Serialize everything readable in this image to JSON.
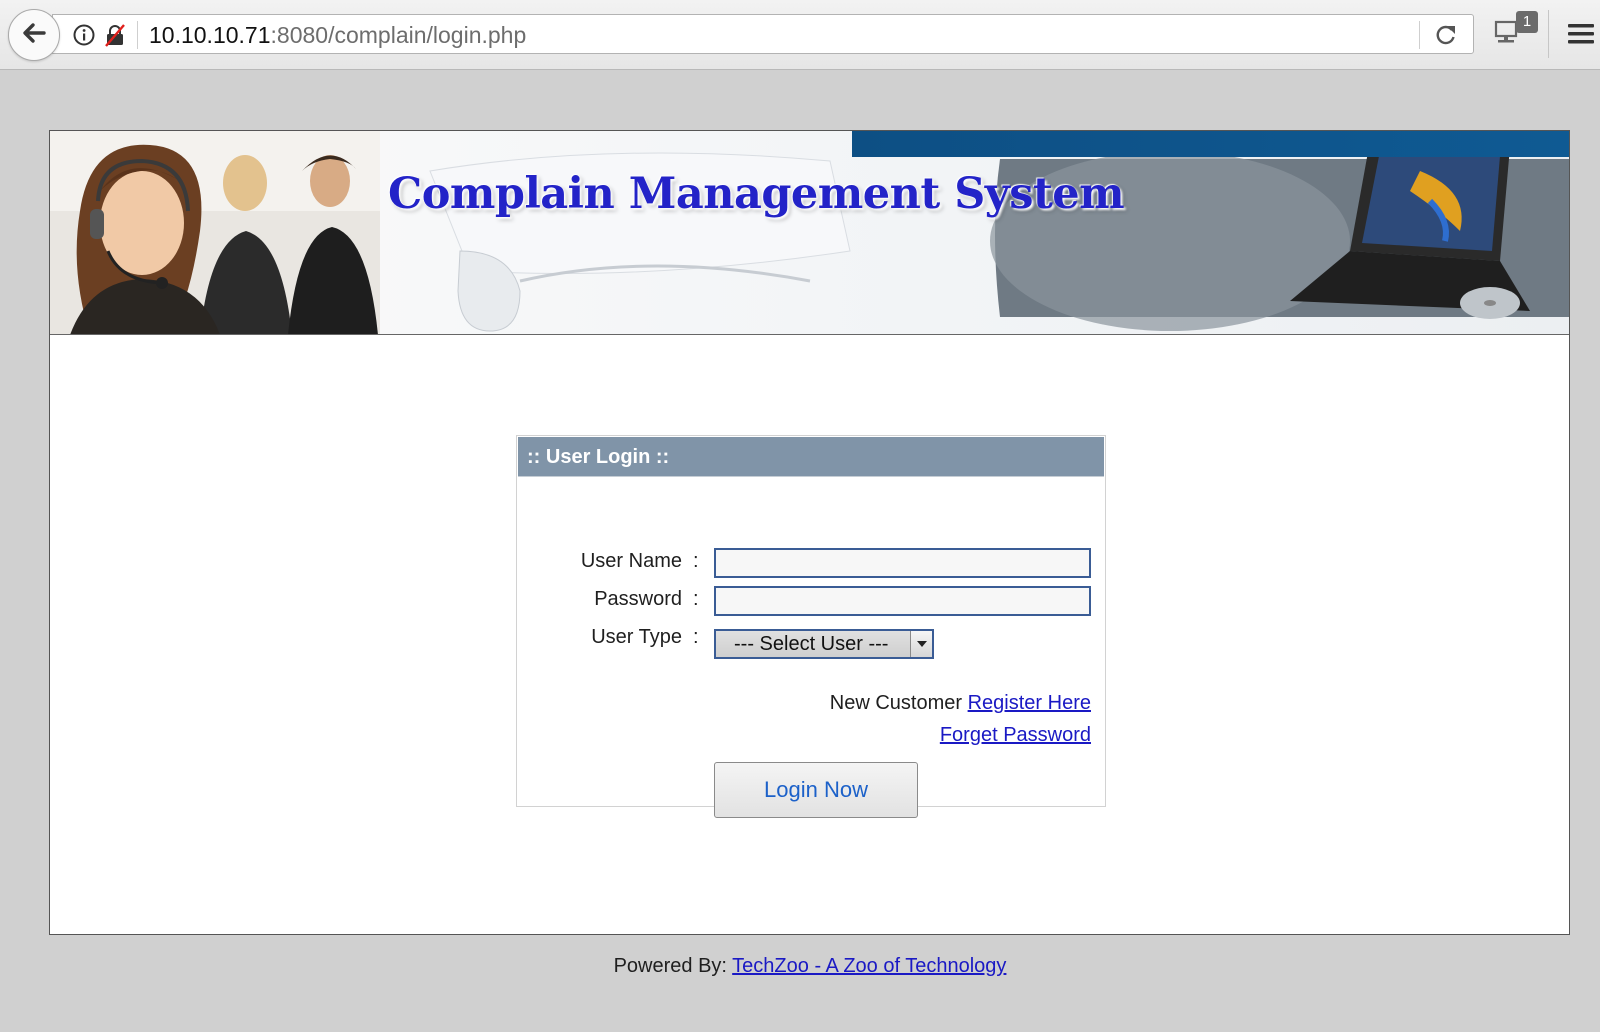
{
  "browser": {
    "url_host": "10.10.10.71",
    "url_path": ":8080/complain/login.php",
    "network_badge": "1",
    "icons": {
      "back": "back-arrow-icon",
      "info": "info-icon",
      "lock": "insecure-lock-icon",
      "reload": "reload-icon",
      "network": "network-icon",
      "menu": "hamburger-menu-icon"
    }
  },
  "banner": {
    "title": "Complain Management System"
  },
  "login": {
    "header": ":: User Login ::",
    "username_label": "User Name",
    "password_label": "Password",
    "usertype_label": "User Type",
    "colon": ":",
    "username_value": "",
    "password_value": "",
    "usertype_selected": "--- Select User ---",
    "new_customer_text": "New Customer",
    "register_link": "Register Here",
    "forget_link": "Forget Password",
    "submit_label": "Login Now"
  },
  "footer": {
    "powered_by": "Powered By:",
    "link": "TechZoo - A Zoo of Technology"
  },
  "colors": {
    "page_bg": "#d0d0d0",
    "header_bg": "#8094a8",
    "title_blue": "#2323c8",
    "link_blue": "#1a19c4",
    "input_border": "#3a5c95",
    "button_text": "#1c61c9"
  }
}
